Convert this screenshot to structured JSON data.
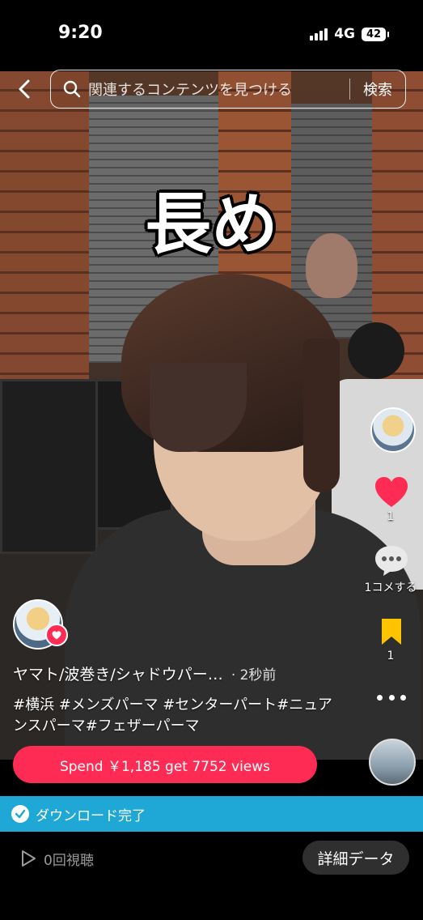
{
  "status_bar": {
    "time": "9:20",
    "network": "4G",
    "battery": "42"
  },
  "search": {
    "placeholder": "関連するコンテンツを見つける",
    "button_label": "検索"
  },
  "overlay_title": "長め",
  "rail": {
    "like_count": "1",
    "comment_label": "1コメする",
    "bookmark_count": "1"
  },
  "post": {
    "title": "ヤマト/波巻き/シャドウパー…",
    "time": "· 2秒前",
    "hashtags": "#横浜 #メンズパーマ #センターパート#ニュアンスパーマ#フェザーパーマ"
  },
  "promote": {
    "label": "Spend ￥1,185 get 7752 views"
  },
  "download": {
    "label": "ダウンロード完了"
  },
  "bottom": {
    "views": "0回視聴",
    "detail_label": "詳細データ"
  },
  "colors": {
    "accent": "#fe2c55",
    "banner": "#1fa8d6"
  },
  "icons": [
    "back-icon",
    "search-icon",
    "heart-icon",
    "comment-icon",
    "bookmark-icon",
    "more-icon",
    "check-icon",
    "play-icon"
  ]
}
